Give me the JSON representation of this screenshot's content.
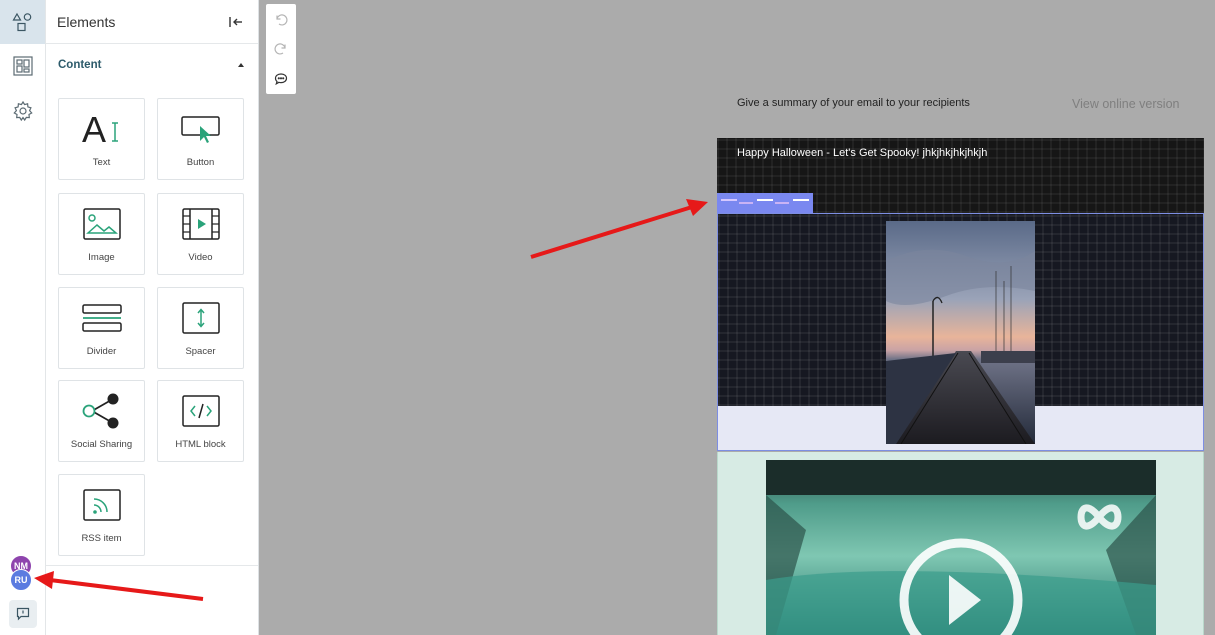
{
  "rail": {
    "items": [
      {
        "name": "elements-icon",
        "active": true
      },
      {
        "name": "layout-blocks-icon",
        "active": false
      },
      {
        "name": "settings-gear-icon",
        "active": false
      }
    ],
    "avatars": [
      "NM",
      "RU"
    ]
  },
  "panel": {
    "title": "Elements",
    "section": "Content",
    "tiles": [
      {
        "label": "Text",
        "icon": "text-icon"
      },
      {
        "label": "Button",
        "icon": "button-icon"
      },
      {
        "label": "Image",
        "icon": "image-icon"
      },
      {
        "label": "Video",
        "icon": "video-icon"
      },
      {
        "label": "Divider",
        "icon": "divider-icon"
      },
      {
        "label": "Spacer",
        "icon": "spacer-icon"
      },
      {
        "label": "Social Sharing",
        "icon": "share-icon"
      },
      {
        "label": "HTML block",
        "icon": "code-icon"
      },
      {
        "label": "RSS item",
        "icon": "rss-icon"
      }
    ]
  },
  "email": {
    "summary_placeholder": "Give a summary of your email to your recipients",
    "view_online": "View online version",
    "header_text": "Happy Halloween - Let's Get Spooky! jhkjhkjhkjhkjh"
  },
  "colors": {
    "accent": "#2d5b6b",
    "icon_green": "#2aa37a",
    "selection": "#7a88f0",
    "annotation_arrow": "#e61919"
  }
}
